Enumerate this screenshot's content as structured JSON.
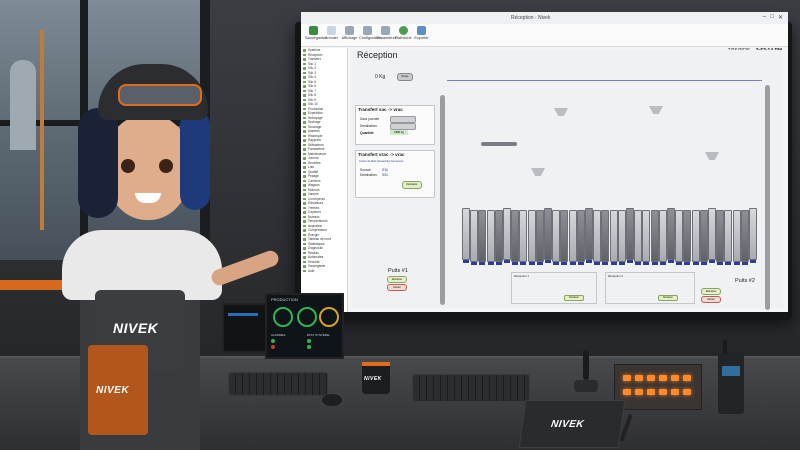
{
  "window_title": "Réception - Nivek",
  "ribbon": {
    "buttons": [
      {
        "label": "Sauvegarder",
        "color": "#3a8d3f"
      },
      {
        "label": "Annuler",
        "color": "#c9d6e4"
      },
      {
        "label": "Affichage",
        "color": "#9aa7b6"
      },
      {
        "label": "Configuration",
        "color": "#9aa7b6"
      },
      {
        "label": "Paramètres",
        "color": "#9aa7b6"
      },
      {
        "label": "Rafraîchir",
        "color": "#4a9c4e"
      },
      {
        "label": "Exporter",
        "color": "#5b8fc9"
      }
    ]
  },
  "clock": {
    "date": "7/26/2026",
    "time": "3:53:14 PM"
  },
  "tree": {
    "items": [
      "Système",
      "Réception",
      "Transfert",
      "Silo 1",
      "Silo 2",
      "Silo 3",
      "Silo 4",
      "Silo 5",
      "Silo 6",
      "Silo 7",
      "Silo 8",
      "Silo 9",
      "Silo 10",
      "Production",
      "Expédition",
      "Nettoyage",
      "Séchage",
      "Stockage",
      "Alarmes",
      "Historique",
      "Rapports",
      "Utilisateurs",
      "Paramètres",
      "Maintenance",
      "Journal",
      "Recettes",
      "Lots",
      "Qualité",
      "Pesage",
      "Camions",
      "Wagons",
      "Moteurs",
      "Vannes",
      "Convoyeurs",
      "Élévateurs",
      "Trémies",
      "Capteurs",
      "Niveaux",
      "Températures",
      "Aspiration",
      "Compresseur",
      "Énergie",
      "Tableau de bord",
      "Statistiques",
      "Diagnostic",
      "Réseau",
      "Automates",
      "Sécurité",
      "Sauvegarde",
      "Aide"
    ]
  },
  "canvas": {
    "title": "Réception",
    "weight": "0 Kg",
    "weight_button": "Pesée",
    "panel1": {
      "title": "Transfert sac -> vrac",
      "rows": [
        {
          "label": "Sacs journée",
          "value": ""
        },
        {
          "label": "Destination:",
          "value": ""
        },
        {
          "label": "Quantité:",
          "value": "2380 kg"
        }
      ]
    },
    "panel2": {
      "title": "Transfert vrac -> vrac",
      "product": "Grains de Maïs (Ensachés) Semences",
      "rows": [
        {
          "label": "Source:",
          "value": "S36"
        },
        {
          "label": "Destination:",
          "value": "S54"
        }
      ],
      "button": "Démarrer"
    },
    "well1": {
      "label": "Puits #1",
      "btn_start": "Démarrer",
      "btn_stop": "Arrêter"
    },
    "well2": {
      "label": "Puits #2",
      "btn_start": "Démarrer",
      "btn_stop": "Arrêter"
    },
    "reception1": {
      "label": "Réception 1",
      "btn": "Démarrer"
    },
    "reception2": {
      "label": "Réception 2",
      "btn": "Démarrer"
    }
  },
  "brand": {
    "name": "NIVEK",
    "accent": "#e26b1c"
  },
  "mini_monitor": {
    "title": "PRODUCTION",
    "alarms_label": "ALARMES",
    "status_label": "ÉTAT SYSTÈME"
  },
  "colors": {
    "screen_bg": "#f4f5f6",
    "silo_blue": "#2c3c9c",
    "orange": "#e26b1c",
    "status_green": "#2fb455"
  }
}
